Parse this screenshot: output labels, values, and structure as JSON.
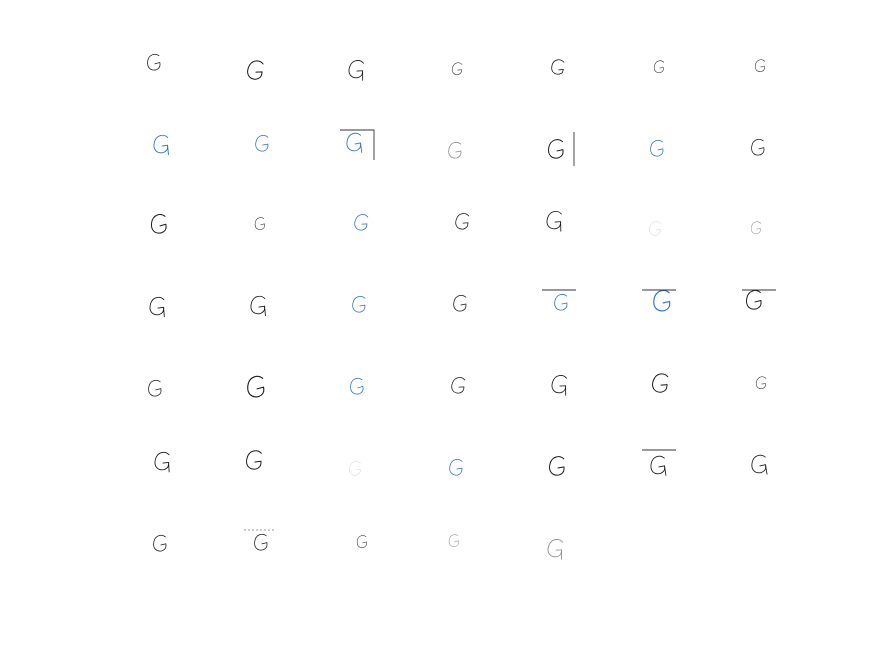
{
  "figure": {
    "rows": 7,
    "cols": 7,
    "ink_colors": {
      "black": "#1a1a1a",
      "blue": "#2a6fc9",
      "gray": "#8a8a8a"
    },
    "samples": [
      {
        "label": "G",
        "ink": "black",
        "variant": "small",
        "frame": "none"
      },
      {
        "label": "G",
        "ink": "black",
        "variant": "medium",
        "frame": "none"
      },
      {
        "label": "G",
        "ink": "black",
        "variant": "tail",
        "frame": "none"
      },
      {
        "label": "G",
        "ink": "black",
        "variant": "tiny",
        "frame": "none"
      },
      {
        "label": "G",
        "ink": "black",
        "variant": "round",
        "frame": "none"
      },
      {
        "label": "G",
        "ink": "black",
        "variant": "tiny",
        "frame": "none"
      },
      {
        "label": "G",
        "ink": "black",
        "variant": "tiny",
        "frame": "none"
      },
      {
        "label": "G",
        "ink": "blue",
        "variant": "tail",
        "frame": "none"
      },
      {
        "label": "G",
        "ink": "blue",
        "variant": "small",
        "frame": "none"
      },
      {
        "label": "G",
        "ink": "blue",
        "variant": "tail",
        "frame": "corner"
      },
      {
        "label": "G",
        "ink": "gray",
        "variant": "small",
        "frame": "none"
      },
      {
        "label": "G",
        "ink": "black",
        "variant": "medium",
        "frame": "right-bar"
      },
      {
        "label": "G",
        "ink": "blue",
        "variant": "small",
        "frame": "none"
      },
      {
        "label": "G",
        "ink": "black",
        "variant": "small",
        "frame": "none"
      },
      {
        "label": "G",
        "ink": "black",
        "variant": "medium",
        "frame": "none"
      },
      {
        "label": "G",
        "ink": "black",
        "variant": "tiny",
        "frame": "none"
      },
      {
        "label": "G",
        "ink": "blue",
        "variant": "small",
        "frame": "none"
      },
      {
        "label": "G",
        "ink": "black",
        "variant": "small",
        "frame": "none"
      },
      {
        "label": "G",
        "ink": "black",
        "variant": "tail",
        "frame": "none"
      },
      {
        "label": "G",
        "ink": "gray",
        "variant": "faint",
        "frame": "none"
      },
      {
        "label": "G",
        "ink": "gray",
        "variant": "tiny",
        "frame": "none"
      },
      {
        "label": "G",
        "ink": "black",
        "variant": "tail",
        "frame": "none"
      },
      {
        "label": "G",
        "ink": "black",
        "variant": "tail",
        "frame": "none"
      },
      {
        "label": "G",
        "ink": "blue",
        "variant": "small",
        "frame": "none"
      },
      {
        "label": "G",
        "ink": "black",
        "variant": "small",
        "frame": "none"
      },
      {
        "label": "G",
        "ink": "blue",
        "variant": "small",
        "frame": "top-bar"
      },
      {
        "label": "G",
        "ink": "blue",
        "variant": "wide",
        "frame": "top-bar"
      },
      {
        "label": "G",
        "ink": "black",
        "variant": "medium",
        "frame": "top-bar"
      },
      {
        "label": "G",
        "ink": "black",
        "variant": "small",
        "frame": "none"
      },
      {
        "label": "G",
        "ink": "black",
        "variant": "wide",
        "frame": "none"
      },
      {
        "label": "G",
        "ink": "blue",
        "variant": "small",
        "frame": "none"
      },
      {
        "label": "G",
        "ink": "black",
        "variant": "small",
        "frame": "none"
      },
      {
        "label": "G",
        "ink": "black",
        "variant": "tail",
        "frame": "none"
      },
      {
        "label": "G",
        "ink": "black",
        "variant": "medium",
        "frame": "none"
      },
      {
        "label": "G",
        "ink": "black",
        "variant": "tiny",
        "frame": "none"
      },
      {
        "label": "G",
        "ink": "black",
        "variant": "tail",
        "frame": "none"
      },
      {
        "label": "G",
        "ink": "black",
        "variant": "medium",
        "frame": "none"
      },
      {
        "label": "G",
        "ink": "gray",
        "variant": "faint",
        "frame": "none"
      },
      {
        "label": "G",
        "ink": "blue",
        "variant": "small",
        "frame": "none"
      },
      {
        "label": "G",
        "ink": "black",
        "variant": "medium",
        "frame": "none"
      },
      {
        "label": "G",
        "ink": "black",
        "variant": "tail",
        "frame": "top-bar"
      },
      {
        "label": "G",
        "ink": "black",
        "variant": "tail",
        "frame": "none"
      },
      {
        "label": "G",
        "ink": "black",
        "variant": "small",
        "frame": "none"
      },
      {
        "label": "G",
        "ink": "black",
        "variant": "small",
        "frame": "top-dash"
      },
      {
        "label": "G",
        "ink": "black",
        "variant": "tiny",
        "frame": "none"
      },
      {
        "label": "G",
        "ink": "gray",
        "variant": "tiny",
        "frame": "none"
      },
      {
        "label": "G",
        "ink": "gray",
        "variant": "tail",
        "frame": "none"
      }
    ]
  }
}
